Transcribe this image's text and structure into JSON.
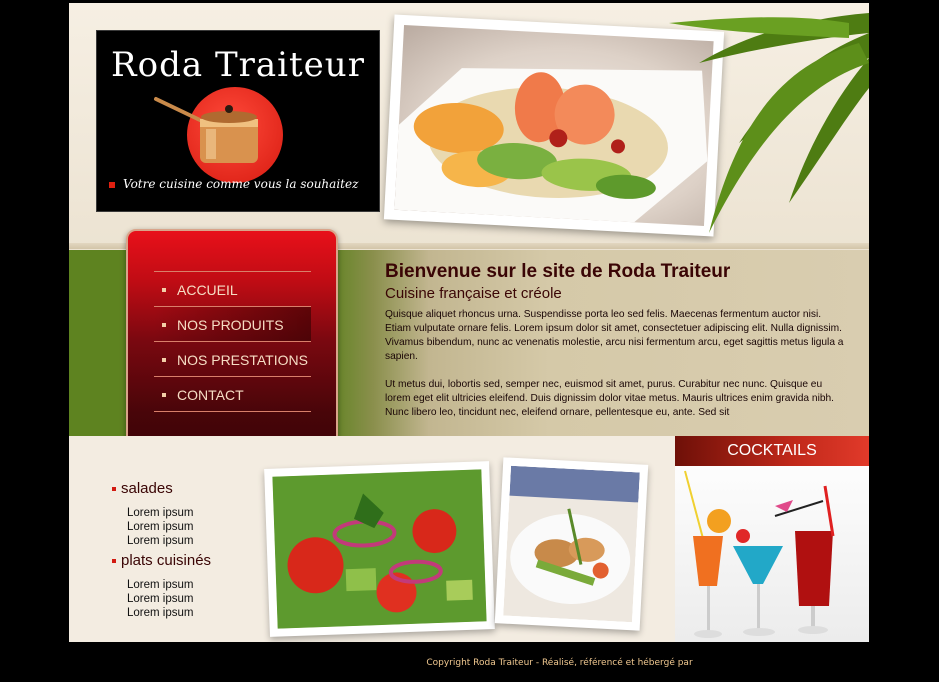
{
  "logo": {
    "title": "Roda Traiteur",
    "tagline": "Votre cuisine comme vous la souhaitez"
  },
  "nav": {
    "items": [
      {
        "label": "ACCUEIL"
      },
      {
        "label": "NOS PRODUITS"
      },
      {
        "label": "NOS PRESTATIONS"
      },
      {
        "label": "CONTACT"
      }
    ]
  },
  "welcome": {
    "title": "Bienvenue sur le site de Roda Traiteur",
    "subtitle": "Cuisine française et créole",
    "paragraph1": "Quisque aliquet rhoncus urna. Suspendisse porta leo sed felis. Maecenas fermentum auctor nisi. Etiam vulputate ornare felis. Lorem ipsum dolor sit amet, consectetuer adipiscing elit. Nulla dignissim. Vivamus bibendum, nunc ac venenatis molestie, arcu nisi fermentum arcu, eget sagittis metus ligula a sapien.",
    "paragraph2": "Ut metus dui, lobortis sed, semper nec, euismod sit amet, purus. Curabitur nec nunc. Quisque eu lorem eget elit ultricies eleifend. Duis dignissim dolor vitae metus. Mauris ultrices enim gravida nibh. Nunc libero leo, tincidunt nec, eleifend ornare, pellentesque eu, ante. Sed sit"
  },
  "categories": [
    {
      "title": "salades",
      "items": [
        "Lorem ipsum",
        "Lorem ipsum",
        "Lorem ipsum"
      ]
    },
    {
      "title": "plats cuisinés",
      "items": [
        "Lorem ipsum",
        "Lorem ipsum",
        "Lorem ipsum"
      ]
    }
  ],
  "cocktails": {
    "title": "COCKTAILS"
  },
  "footer": {
    "text": "Copyright Roda Traiteur - Réalisé, référencé et hébergé par"
  },
  "colors": {
    "accent_red": "#c0281a",
    "nav_dark": "#480509",
    "green_band": "#5e8320",
    "cream": "#f3ece1"
  }
}
